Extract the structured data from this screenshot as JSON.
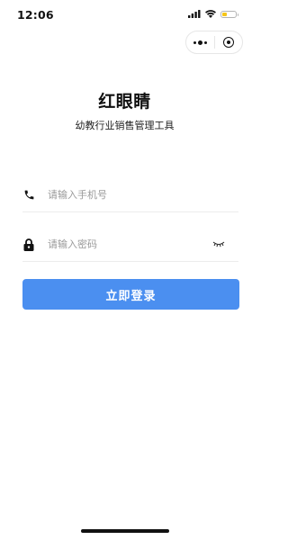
{
  "status_bar": {
    "time": "12:06",
    "battery_color": "#f5c518"
  },
  "capsule": {
    "more_icon": "more-dots-icon",
    "close_icon": "target-close-icon"
  },
  "app": {
    "title": "红眼睛",
    "subtitle": "幼教行业销售管理工具"
  },
  "form": {
    "phone": {
      "icon": "phone-icon",
      "placeholder": "请输入手机号",
      "value": ""
    },
    "password": {
      "icon": "lock-icon",
      "placeholder": "请输入密码",
      "value": "",
      "toggle_icon": "eye-closed-icon"
    },
    "login_label": "立即登录"
  },
  "colors": {
    "accent": "#4b8ff0",
    "text": "#111111",
    "placeholder": "#9a9a9a",
    "divider": "#ececec"
  }
}
